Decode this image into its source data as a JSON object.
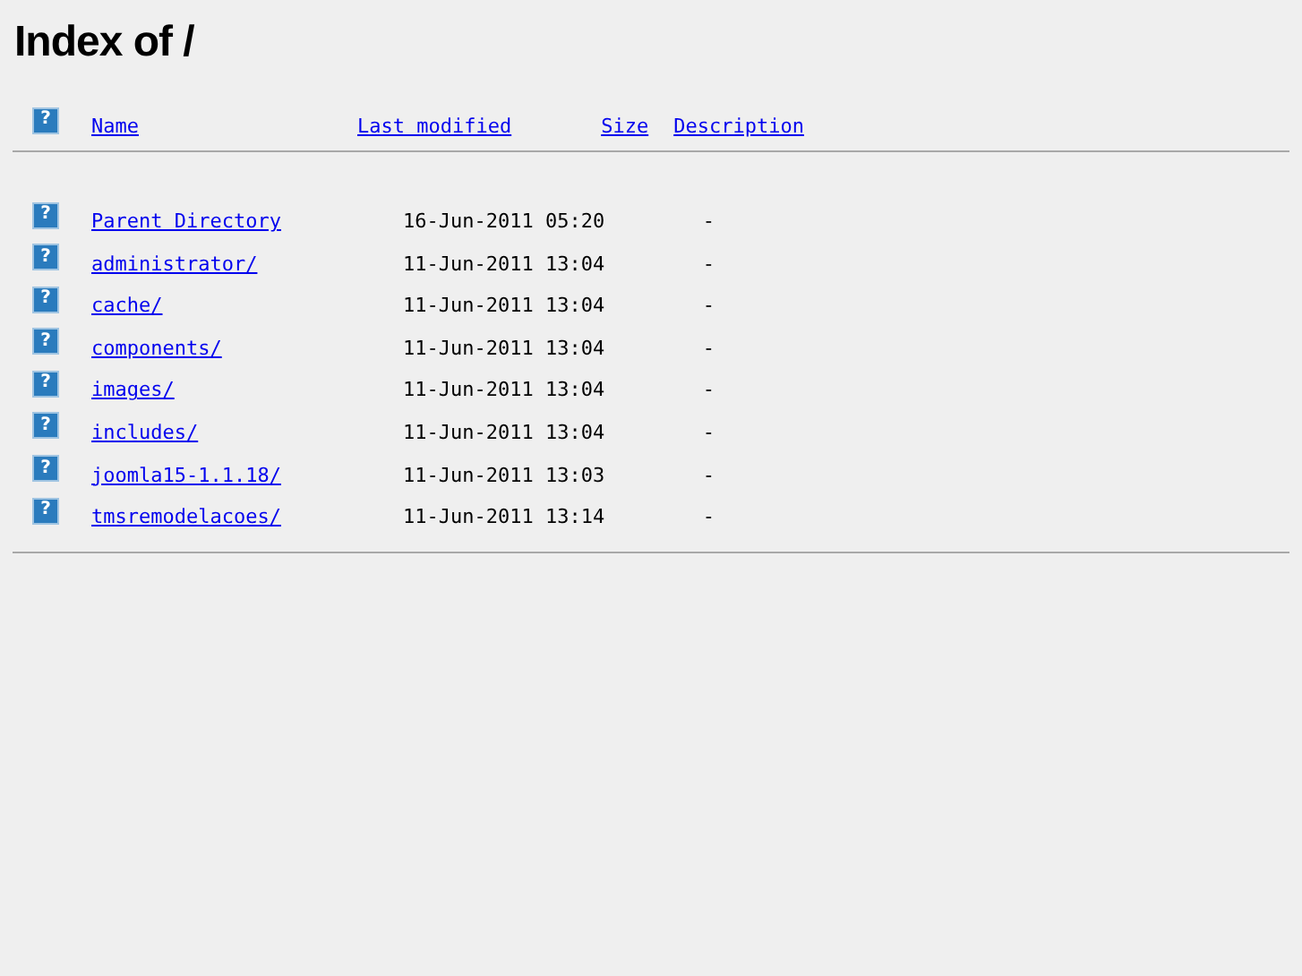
{
  "title": "Index of /",
  "header": {
    "icon": "?",
    "columns": [
      "Name",
      "Last modified",
      "Size",
      "Description"
    ]
  },
  "rows": [
    {
      "icon": "?",
      "name": "Parent Directory",
      "modified": "16-Jun-2011 05:20",
      "size": "-"
    },
    {
      "icon": "?",
      "name": "administrator/",
      "modified": "11-Jun-2011 13:04",
      "size": "-"
    },
    {
      "icon": "?",
      "name": "cache/",
      "modified": "11-Jun-2011 13:04",
      "size": "-"
    },
    {
      "icon": "?",
      "name": "components/",
      "modified": "11-Jun-2011 13:04",
      "size": "-"
    },
    {
      "icon": "?",
      "name": "images/",
      "modified": "11-Jun-2011 13:04",
      "size": "-"
    },
    {
      "icon": "?",
      "name": "includes/",
      "modified": "11-Jun-2011 13:04",
      "size": "-"
    },
    {
      "icon": "?",
      "name": "joomla15-1.1.18/",
      "modified": "11-Jun-2011 13:03",
      "size": "-"
    },
    {
      "icon": "?",
      "name": "tmsremodelacoes/",
      "modified": "11-Jun-2011 13:14",
      "size": "-"
    }
  ]
}
